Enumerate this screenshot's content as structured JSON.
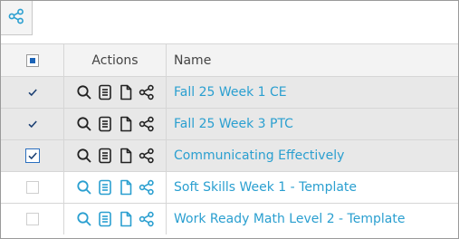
{
  "columns": {
    "actions": "Actions",
    "name": "Name"
  },
  "rows": [
    {
      "name": "Fall 25 Week 1 CE",
      "selected": true
    },
    {
      "name": "Fall 25 Week 3 PTC",
      "selected": true
    },
    {
      "name": "Communicating Effectively",
      "selected": true
    },
    {
      "name": "Soft Skills Week 1 - Template",
      "selected": false
    },
    {
      "name": "Work Ready Math Level 2 - Template",
      "selected": false
    }
  ],
  "colors": {
    "link": "#2a9fd0",
    "icon_dark": "#222222",
    "icon_accent": "#2a9fd0",
    "selected_row": "#e8e8e8",
    "checkbox_accent": "#1b63b7"
  }
}
